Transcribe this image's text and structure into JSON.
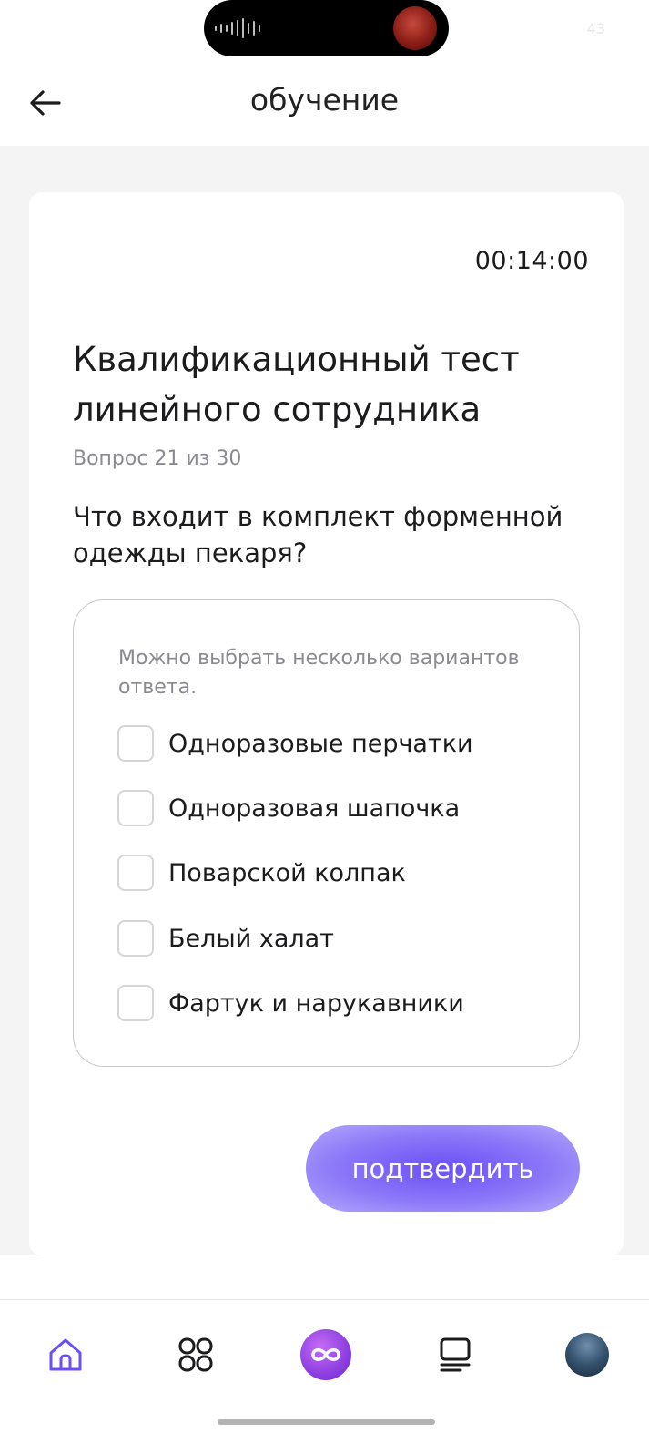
{
  "status_bar": {
    "number": "43"
  },
  "header": {
    "title": "обучение"
  },
  "card": {
    "timer": "00:14:00",
    "test_title": "Квалификационный тест линейного сотрудника",
    "progress": "Вопрос 21 из 30",
    "question": "Что входит в комплект форменной одежды пекаря?",
    "hint": "Можно выбрать несколько вариантов ответа.",
    "options": [
      {
        "label": "Одноразовые перчатки",
        "checked": false
      },
      {
        "label": "Одноразовая шапочка",
        "checked": false
      },
      {
        "label": "Поварской колпак",
        "checked": false
      },
      {
        "label": "Белый халат",
        "checked": false
      },
      {
        "label": "Фартук и нарукавники",
        "checked": false
      }
    ],
    "confirm_label": "подтвердить"
  },
  "bottom_nav": {
    "items": [
      {
        "icon": "home-icon",
        "active": true
      },
      {
        "icon": "grid-icon",
        "active": false
      },
      {
        "icon": "infinity-icon",
        "active": false
      },
      {
        "icon": "courses-icon",
        "active": false
      },
      {
        "icon": "avatar",
        "active": false
      }
    ]
  },
  "colors": {
    "accent": "#6b4ff5",
    "nav_active": "#6b4ff5",
    "background": "#f4f4f4",
    "secondary_text": "#8a8a90"
  }
}
